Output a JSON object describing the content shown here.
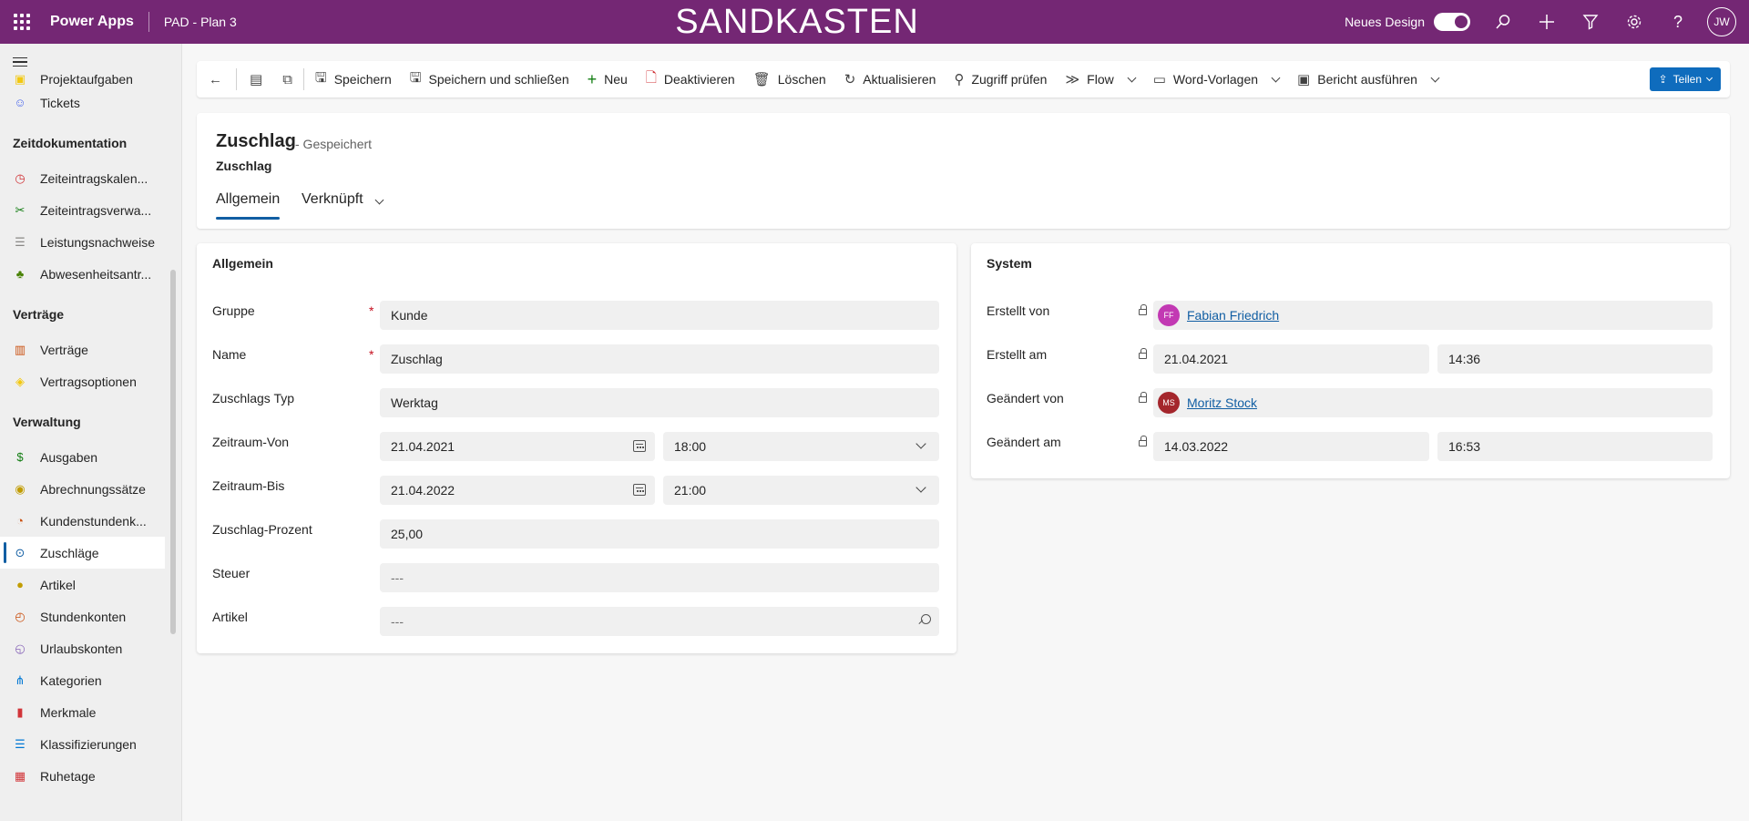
{
  "topbar": {
    "app_name": "Power Apps",
    "env_name": "PAD - Plan 3",
    "banner": "SANDKASTEN",
    "new_design_label": "Neues Design",
    "avatar_initials": "JW"
  },
  "sidebar": {
    "partial_item": "Projektaufgaben",
    "tickets": "Tickets",
    "section_time": "Zeitdokumentation",
    "time_items": [
      "Zeiteintragskalen...",
      "Zeiteintragsverwa...",
      "Leistungsnachweise",
      "Abwesenheitsantr..."
    ],
    "section_contracts": "Verträge",
    "contract_items": [
      "Verträge",
      "Vertragsoptionen"
    ],
    "section_admin": "Verwaltung",
    "admin_items": [
      "Ausgaben",
      "Abrechnungssätze",
      "Kundenstundenk...",
      "Zuschläge",
      "Artikel",
      "Stundenkonten",
      "Urlaubskonten",
      "Kategorien",
      "Merkmale",
      "Klassifizierungen",
      "Ruhetage"
    ]
  },
  "commandbar": {
    "save": "Speichern",
    "save_close": "Speichern und schließen",
    "new": "Neu",
    "deactivate": "Deaktivieren",
    "delete": "Löschen",
    "refresh": "Aktualisieren",
    "check_access": "Zugriff prüfen",
    "flow": "Flow",
    "word_templates": "Word-Vorlagen",
    "run_report": "Bericht ausführen",
    "share": "Teilen"
  },
  "header": {
    "title": "Zuschlag",
    "status": "- Gespeichert",
    "entity": "Zuschlag",
    "tab_general": "Allgemein",
    "tab_related": "Verknüpft"
  },
  "general": {
    "title": "Allgemein",
    "group_label": "Gruppe",
    "group_value": "Kunde",
    "name_label": "Name",
    "name_value": "Zuschlag",
    "type_label": "Zuschlags Typ",
    "type_value": "Werktag",
    "from_label": "Zeitraum-Von",
    "from_date": "21.04.2021",
    "from_time": "18:00",
    "to_label": "Zeitraum-Bis",
    "to_date": "21.04.2022",
    "to_time": "21:00",
    "percent_label": "Zuschlag-Prozent",
    "percent_value": "25,00",
    "tax_label": "Steuer",
    "tax_value": "---",
    "article_label": "Artikel",
    "article_value": "---",
    "required_mark": "*"
  },
  "system": {
    "title": "System",
    "created_by_label": "Erstellt von",
    "created_by_initials": "FF",
    "created_by_name": "Fabian Friedrich",
    "created_on_label": "Erstellt am",
    "created_on_date": "21.04.2021",
    "created_on_time": "14:36",
    "modified_by_label": "Geändert von",
    "modified_by_initials": "MS",
    "modified_by_name": "Moritz Stock",
    "modified_on_label": "Geändert am",
    "modified_on_date": "14.03.2022",
    "modified_on_time": "16:53"
  },
  "colors": {
    "topbar": "#742774",
    "accent": "#115ea3",
    "share_button": "#0f6cbd",
    "required": "#c50f1f",
    "persona_ff": "#c239b3",
    "persona_ms": "#a4262c"
  }
}
